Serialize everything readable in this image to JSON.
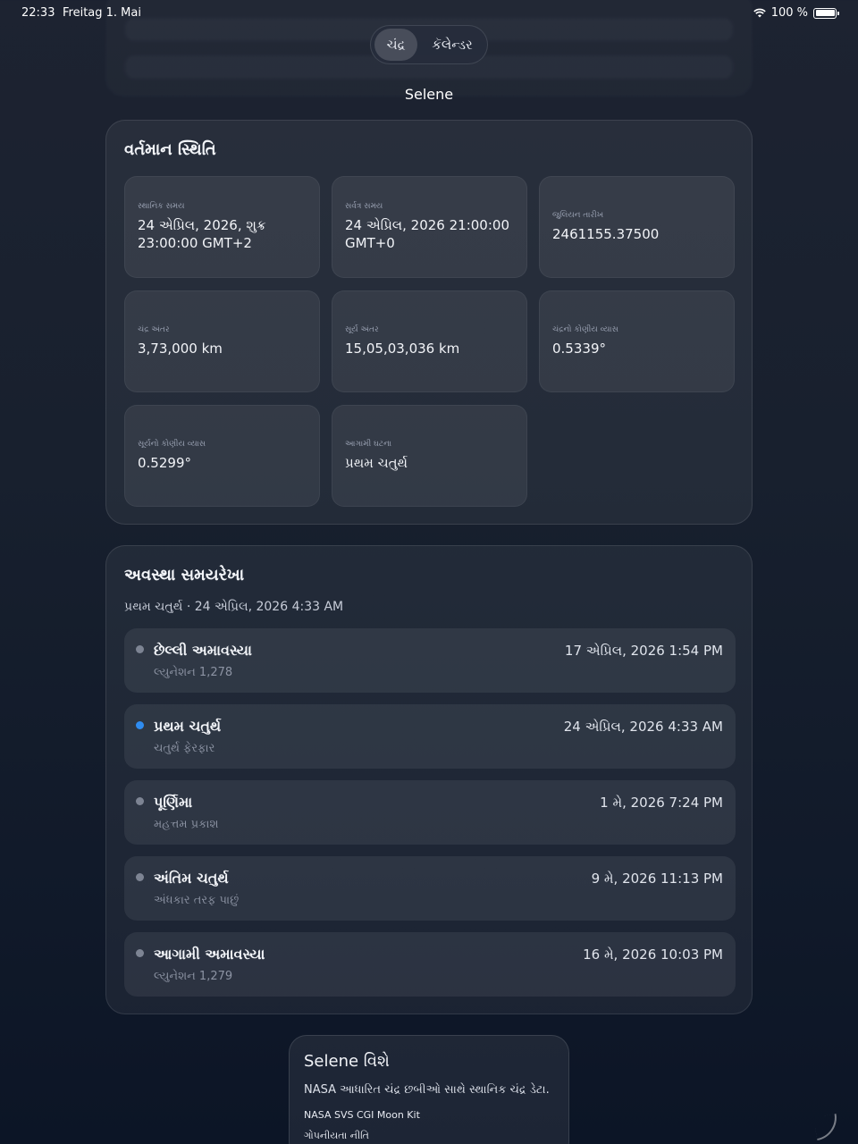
{
  "status_bar": {
    "time": "22:33",
    "date": "Freitag 1. Mai",
    "battery": "100 %",
    "wifi_icon": "wifi-icon",
    "battery_icon": "battery-icon"
  },
  "segmented": {
    "tabs": [
      {
        "label": "ચંદ્ર",
        "active": true
      },
      {
        "label": "કૅલેન્ડર",
        "active": false
      }
    ]
  },
  "app_title": "Selene",
  "current_state": {
    "title": "વર્તમાન સ્થિતિ",
    "stats": [
      {
        "label": "સ્થાનિક સમય",
        "value": "24 એપ્રિલ, 2026, શુક્ર 23:00:00 GMT+2"
      },
      {
        "label": "સર્વત્ર સમય",
        "value": "24 એપ્રિલ, 2026 21:00:00 GMT+0"
      },
      {
        "label": "જુલિયન તારીખ",
        "value": "2461155.37500"
      },
      {
        "label": "ચંદ્ર અંતર",
        "value": "3,73,000 km"
      },
      {
        "label": "સૂર્ય અંતર",
        "value": "15,05,03,036 km"
      },
      {
        "label": "ચંદ્રનો કોણીય વ્યાસ",
        "value": "0.5339°"
      },
      {
        "label": "સૂર્યનો કોણીય વ્યાસ",
        "value": "0.5299°"
      },
      {
        "label": "આગામી ઘટના",
        "value": "પ્રથમ ચતુર્થ"
      }
    ]
  },
  "timeline": {
    "title": "અવસ્થા સમયરેખા",
    "subtitle": "પ્રથમ ચતુર્થ · 24 એપ્રિલ, 2026 4:33 AM",
    "phases": [
      {
        "name": "છેલ્લી અમાવસ્યા",
        "desc": "લ્યુનેશન 1,278",
        "date": "17 એપ્રિલ, 2026 1:54 PM",
        "current": false
      },
      {
        "name": "પ્રથમ ચતુર્થ",
        "desc": "ચતુર્થ ફેરફાર",
        "date": "24 એપ્રિલ, 2026 4:33 AM",
        "current": true
      },
      {
        "name": "પૂર્ણિમા",
        "desc": "મહત્તમ પ્રકાશ",
        "date": "1 મે, 2026 7:24 PM",
        "current": false
      },
      {
        "name": "અંતિમ ચતુર્થ",
        "desc": "અંધકાર તરફ પાછું",
        "date": "9 મે, 2026 11:13 PM",
        "current": false
      },
      {
        "name": "આગામી અમાવસ્યા",
        "desc": "લ્યુનેશન 1,279",
        "date": "16 મે, 2026 10:03 PM",
        "current": false
      }
    ]
  },
  "about": {
    "title": "Selene વિશે",
    "text": "NASA આધારિત ચંદ્ર છબીઓ સાથે સ્થાનિક ચંદ્ર ડેટા.",
    "link1": "NASA SVS CGI Moon Kit",
    "link2": "ગોપનીયતા નીતિ"
  }
}
